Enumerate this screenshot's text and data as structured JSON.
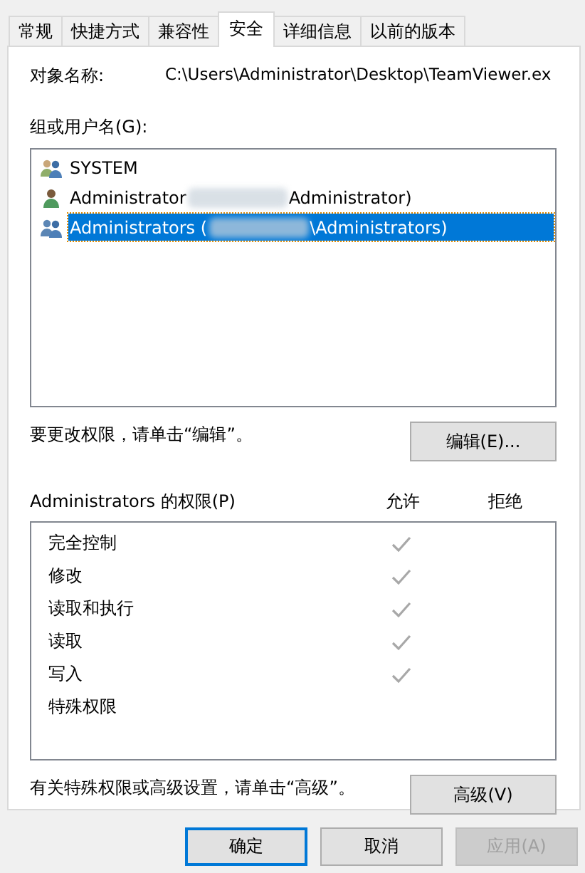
{
  "tabs": [
    {
      "label": "常规",
      "selected": false
    },
    {
      "label": "快捷方式",
      "selected": false
    },
    {
      "label": "兼容性",
      "selected": false
    },
    {
      "label": "安全",
      "selected": true
    },
    {
      "label": "详细信息",
      "selected": false
    },
    {
      "label": "以前的版本",
      "selected": false
    }
  ],
  "object_name": {
    "label": "对象名称:",
    "value": "C:\\Users\\Administrator\\Desktop\\TeamViewer.ex"
  },
  "groups": {
    "label": "组或用户名(G):",
    "items": [
      {
        "kind": "group",
        "name": "SYSTEM",
        "redacted": false,
        "selected": false
      },
      {
        "kind": "user",
        "name": "Administrator",
        "redacted": true,
        "suffix": "Administrator)",
        "selected": false
      },
      {
        "kind": "group",
        "name": "Administrators (",
        "redacted": true,
        "suffix": "\\Administrators)",
        "selected": true
      }
    ]
  },
  "edit_hint": "要更改权限，请单击“编辑”。",
  "edit_button": "编辑(E)...",
  "permissions": {
    "label": "Administrators 的权限(P)",
    "allow_label": "允许",
    "deny_label": "拒绝",
    "rows": [
      {
        "name": "完全控制",
        "allow": true,
        "deny": false
      },
      {
        "name": "修改",
        "allow": true,
        "deny": false
      },
      {
        "name": "读取和执行",
        "allow": true,
        "deny": false
      },
      {
        "name": "读取",
        "allow": true,
        "deny": false
      },
      {
        "name": "写入",
        "allow": true,
        "deny": false
      },
      {
        "name": "特殊权限",
        "allow": false,
        "deny": false
      }
    ]
  },
  "advanced_hint": "有关特殊权限或高级设置，请单击“高级”。",
  "advanced_button": "高级(V)",
  "buttons": [
    {
      "label": "确定",
      "disabled": false,
      "default": true
    },
    {
      "label": "取消",
      "disabled": false,
      "default": false
    },
    {
      "label": "应用(A)",
      "disabled": true,
      "default": false
    }
  ]
}
